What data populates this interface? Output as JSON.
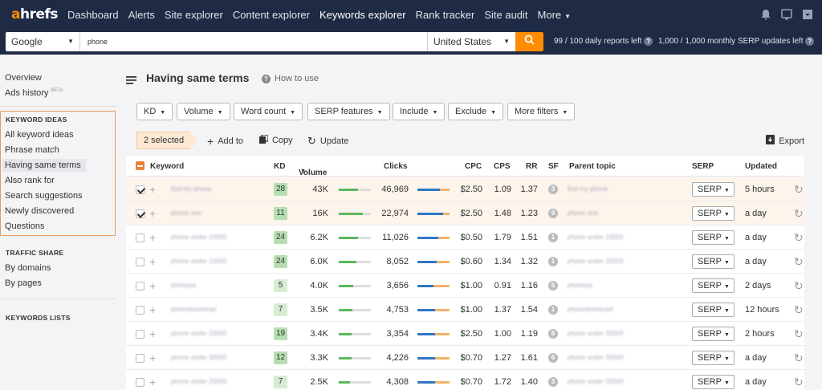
{
  "nav": {
    "logo": "ahrefs",
    "items": [
      "Dashboard",
      "Alerts",
      "Site explorer",
      "Content explorer",
      "Keywords explorer",
      "Rank tracker",
      "Site audit",
      "More"
    ],
    "active": "Keywords explorer"
  },
  "search": {
    "engine": "Google",
    "query": "phone",
    "country": "United States",
    "daily_reports": "99 / 100 daily reports left",
    "serp_updates": "1,000 / 1,000 monthly SERP updates left"
  },
  "sidebar": {
    "overview": "Overview",
    "ads_history": "Ads history",
    "beta": "BETA",
    "keyword_ideas_heading": "KEYWORD IDEAS",
    "keyword_ideas": [
      "All keyword ideas",
      "Phrase match",
      "Having same terms",
      "Also rank for",
      "Search suggestions",
      "Newly discovered",
      "Questions"
    ],
    "selected_idea": "Having same terms",
    "traffic_share_heading": "TRAFFIC SHARE",
    "traffic_share": [
      "By domains",
      "By pages"
    ],
    "keywords_lists_heading": "KEYWORDS LISTS"
  },
  "main": {
    "title": "Having same terms",
    "how_to": "How to use",
    "filters": [
      "KD",
      "Volume",
      "Word count",
      "SERP features",
      "Include",
      "Exclude",
      "More filters"
    ],
    "selected_count": "2 selected",
    "add_to": "Add to",
    "copy": "Copy",
    "update": "Update",
    "export": "Export"
  },
  "table": {
    "headers": {
      "keyword": "Keyword",
      "kd": "KD",
      "volume": "Volume",
      "clicks": "Clicks",
      "cpc": "CPC",
      "cps": "CPS",
      "rr": "RR",
      "sf": "SF",
      "parent_topic": "Parent topic",
      "serp": "SERP",
      "updated": "Updated"
    },
    "serp_label": "SERP",
    "rows": [
      {
        "keyword": "find my phone",
        "kd": "28",
        "volume": "43K",
        "vol_frac": 0.6,
        "clicks": "46,969",
        "click_frac": 0.7,
        "cpc": "$2.50",
        "cps": "1.09",
        "rr": "1.37",
        "sf": "3",
        "parent": "find my phone",
        "updated": "5 hours",
        "checked": true
      },
      {
        "keyword": "phone one",
        "kd": "11",
        "volume": "16K",
        "vol_frac": 0.75,
        "clicks": "22,974",
        "click_frac": 0.8,
        "cpc": "$2.50",
        "cps": "1.48",
        "rr": "1.23",
        "sf": "9",
        "parent": "phone one",
        "updated": "a day",
        "checked": true
      },
      {
        "keyword": "phone under 10000",
        "kd": "24",
        "volume": "6.2K",
        "vol_frac": 0.6,
        "clicks": "11,026",
        "click_frac": 0.65,
        "cpc": "$0.50",
        "cps": "1.79",
        "rr": "1.51",
        "sf": "1",
        "parent": "phone under 10000",
        "updated": "a day",
        "checked": false
      },
      {
        "keyword": "phone under 15000",
        "kd": "24",
        "volume": "6.0K",
        "vol_frac": 0.55,
        "clicks": "8,052",
        "click_frac": 0.6,
        "cpc": "$0.60",
        "cps": "1.34",
        "rr": "1.32",
        "sf": "1",
        "parent": "phone under 15000",
        "updated": "a day",
        "checked": false
      },
      {
        "keyword": "phonepe",
        "kd": "5",
        "volume": "4.0K",
        "vol_frac": 0.45,
        "clicks": "3,656",
        "click_frac": 0.5,
        "cpc": "$1.00",
        "cps": "0.91",
        "rr": "1.16",
        "sf": "5",
        "parent": "phonepe",
        "updated": "2 days",
        "checked": false
      },
      {
        "keyword": "phonedownload",
        "kd": "7",
        "volume": "3.5K",
        "vol_frac": 0.42,
        "clicks": "4,753",
        "click_frac": 0.55,
        "cpc": "$1.00",
        "cps": "1.37",
        "rr": "1.54",
        "sf": "1",
        "parent": "phonedownload",
        "updated": "12 hours",
        "checked": false
      },
      {
        "keyword": "phone under 20000",
        "kd": "19",
        "volume": "3.4K",
        "vol_frac": 0.4,
        "clicks": "3,354",
        "click_frac": 0.55,
        "cpc": "$2.50",
        "cps": "1.00",
        "rr": "1.19",
        "sf": "8",
        "parent": "phone under 20000",
        "updated": "2 hours",
        "checked": false
      },
      {
        "keyword": "phone under 30000",
        "kd": "12",
        "volume": "3.3K",
        "vol_frac": 0.4,
        "clicks": "4,226",
        "click_frac": 0.55,
        "cpc": "$0.70",
        "cps": "1.27",
        "rr": "1.61",
        "sf": "6",
        "parent": "phone under 30000",
        "updated": "a day",
        "checked": false
      },
      {
        "keyword": "phone under 25000",
        "kd": "7",
        "volume": "2.5K",
        "vol_frac": 0.35,
        "clicks": "4,308",
        "click_frac": 0.55,
        "cpc": "$0.70",
        "cps": "1.72",
        "rr": "1.40",
        "sf": "3",
        "parent": "phone under 25000",
        "updated": "a day",
        "checked": false
      }
    ]
  },
  "colors": {
    "nav_bg": "#1f2a44",
    "accent": "#ff8c00",
    "volume_bar": "#5cb85c",
    "click_bar_paid": "#2f78c4",
    "click_bar_organic": "#f0b26c"
  }
}
